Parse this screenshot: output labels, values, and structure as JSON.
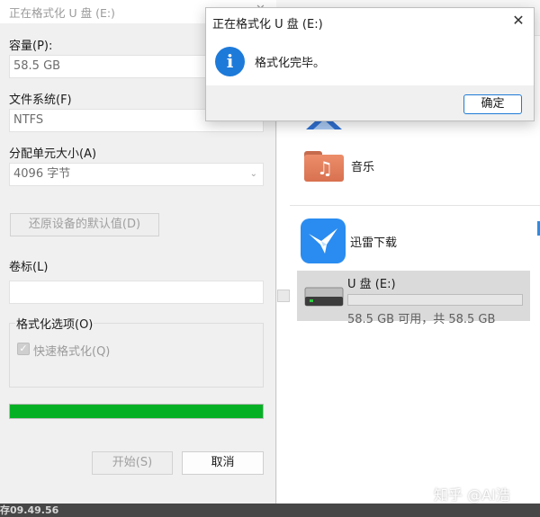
{
  "explorer": {
    "music_folder_label": "音乐",
    "xunlei_label": "迅雷下载",
    "drive": {
      "name": "U 盘 (E:)",
      "capacity_text": "58.5 GB 可用，共 58.5 GB",
      "used_fraction": 0.0
    }
  },
  "format_dialog": {
    "title": "正在格式化 U 盘 (E:)",
    "capacity_label": "容量(P):",
    "capacity_value": "58.5 GB",
    "filesystem_label": "文件系统(F)",
    "filesystem_value": "NTFS",
    "allocation_label": "分配单元大小(A)",
    "allocation_value": "4096 字节",
    "restore_defaults_button": "还原设备的默认值(D)",
    "volume_label_label": "卷标(L)",
    "volume_label_value": "",
    "options_group_title": "格式化选项(O)",
    "quick_format_label": "快速格式化(Q)",
    "quick_format_checked": true,
    "progress_fraction": 1.0,
    "start_button": "开始(S)",
    "cancel_button": "取消"
  },
  "message_box": {
    "title": "正在格式化 U 盘 (E:)",
    "message": "格式化完毕。",
    "ok_button": "确定",
    "close_glyph": "✕",
    "icon": "info-icon"
  },
  "taskbar": {
    "partial_text": "存09.49.56"
  },
  "watermark": "知乎 @AI浩",
  "colors": {
    "progress_green": "#06b025",
    "accent_blue": "#1e7bd6",
    "info_icon_blue": "#1d7ad9",
    "folder_orange": "#ec8d6a",
    "xunlei_blue": "#2a8cf0"
  }
}
